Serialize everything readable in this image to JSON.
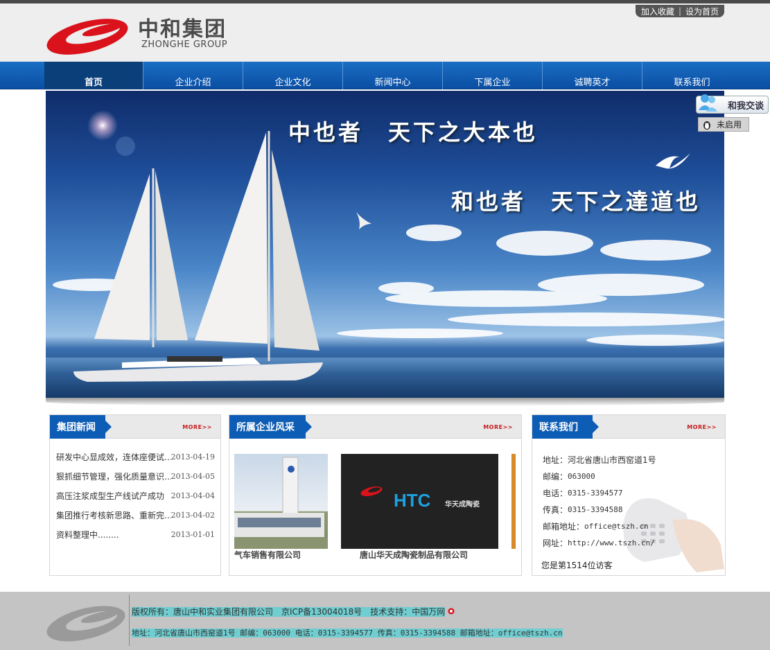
{
  "header": {
    "logo_cn": "中和集团",
    "logo_en": "ZHONGHE GROUP",
    "links": [
      "加入收藏",
      "设为首页"
    ],
    "brand_color": "#d9121b"
  },
  "nav": {
    "items": [
      "首页",
      "企业介绍",
      "企业文化",
      "新闻中心",
      "下属企业",
      "诚聘英才",
      "联系我们"
    ],
    "active": "首页",
    "color": "#0d5cb5"
  },
  "banner": {
    "slogan1": "中也者　天下之大本也",
    "slogan2": "和也者　天下之達道也"
  },
  "chat": {
    "label": "和我交谈",
    "status": "未启用"
  },
  "news_panel": {
    "title": "集团新闻",
    "more": "MORE>>",
    "items": [
      {
        "title": "研发中心显成效，连体座便试…",
        "date": "2013-04-19"
      },
      {
        "title": "狠抓细节管理，强化质量意识…",
        "date": "2013-04-05"
      },
      {
        "title": "高压注浆成型生产线试产成功",
        "date": "2013-04-04"
      },
      {
        "title": "集团推行考核新思路、重新完…",
        "date": "2013-04-02"
      },
      {
        "title": "资料整理中........",
        "date": "2013-01-01"
      }
    ]
  },
  "subs_panel": {
    "title": "所属企业风采",
    "more": "MORE>>",
    "captions": [
      "气车销售有限公司",
      "唐山华天成陶瓷制品有限公司"
    ],
    "htc_logo_text": "HTC",
    "htc_logo_cn": "华天成陶瓷"
  },
  "contact_panel": {
    "title": "联系我们",
    "more": "MORE>>",
    "items": [
      {
        "label": "地址：",
        "value": "河北省唐山市西窑道1号"
      },
      {
        "label": "邮编：",
        "value": "063000"
      },
      {
        "label": "电话：",
        "value": "0315-3394577"
      },
      {
        "label": "传真：",
        "value": "0315-3394588"
      },
      {
        "label": "邮箱地址：",
        "value": "office@tszh.cn"
      },
      {
        "label": "网址：",
        "value": "http://www.tszh.cn/"
      }
    ],
    "visitor": "您是第1514位访客"
  },
  "footer": {
    "line1": "版权所有：唐山中和实业集团有限公司　京ICP备13004018号　技术支持：中国万网",
    "line2": "地址：河北省唐山市西窑道1号 邮编：063000 电话：0315-3394577 传真：0315-3394588 邮箱地址：office@tszh.cn"
  }
}
